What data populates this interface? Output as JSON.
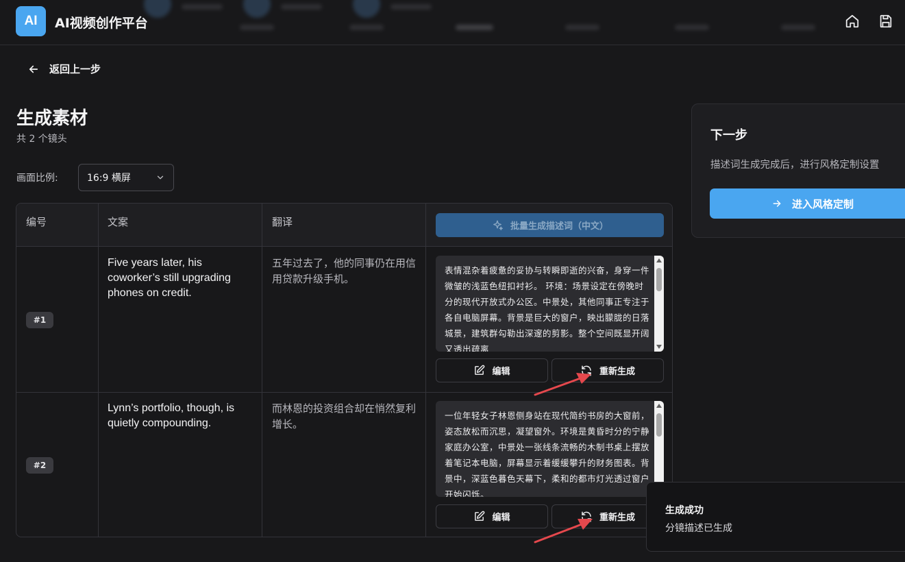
{
  "header": {
    "logo": "AI",
    "title": "AI视频创作平台",
    "icons": [
      "home-icon",
      "save-icon"
    ]
  },
  "nav": {
    "back_label": "返回上一步"
  },
  "page": {
    "title": "生成素材",
    "shot_count": "共 2 个镜头"
  },
  "ratio": {
    "label": "画面比例:",
    "value": "16:9 横屏"
  },
  "table": {
    "headers": {
      "number": "编号",
      "copy": "文案",
      "translation": "翻译"
    },
    "batch_button": "批量生成描述词（中文）",
    "rows": [
      {
        "badge": "#1",
        "copy": "Five years later, his coworker’s still upgrading phones on credit.",
        "translation": "五年过去了，他的同事仍在用信用贷款升级手机。",
        "description": "表情混杂着疲惫的妥协与转瞬即逝的兴奋，身穿一件微皱的浅蓝色纽扣衬衫。 环境：场景设定在傍晚时分的现代开放式办公区。中景处，其他同事正专注于各自电脑屏幕。背景是巨大的窗户，映出朦胧的日落城景，建筑群勾勒出深邃的剪影。整个空间既显开阔又透出疏离",
        "edit_label": "编辑",
        "regen_label": "重新生成"
      },
      {
        "badge": "#2",
        "copy": "Lynn’s portfolio, though, is quietly compounding.",
        "translation": "而林恩的投资组合却在悄然复利增长。",
        "description": "一位年轻女子林恩侧身站在现代简约书房的大窗前，姿态放松而沉思，凝望窗外。环境是黄昏时分的宁静家庭办公室，中景处一张线条流畅的木制书桌上摆放着笔记本电脑，屏幕显示着缓缓攀升的财务图表。背景中，深蓝色暮色天幕下，柔和的都市灯光透过窗户开始闪烁。",
        "edit_label": "编辑",
        "regen_label": "重新生成"
      }
    ]
  },
  "next_step": {
    "title": "下一步",
    "description": "描述词生成完成后，进行风格定制设置",
    "button": "进入风格定制"
  },
  "toast": {
    "title": "生成成功",
    "message": "分镜描述已生成"
  },
  "colors": {
    "accent": "#4aa6f0",
    "annotation_arrow": "#e5484d",
    "background": "#18181a"
  }
}
